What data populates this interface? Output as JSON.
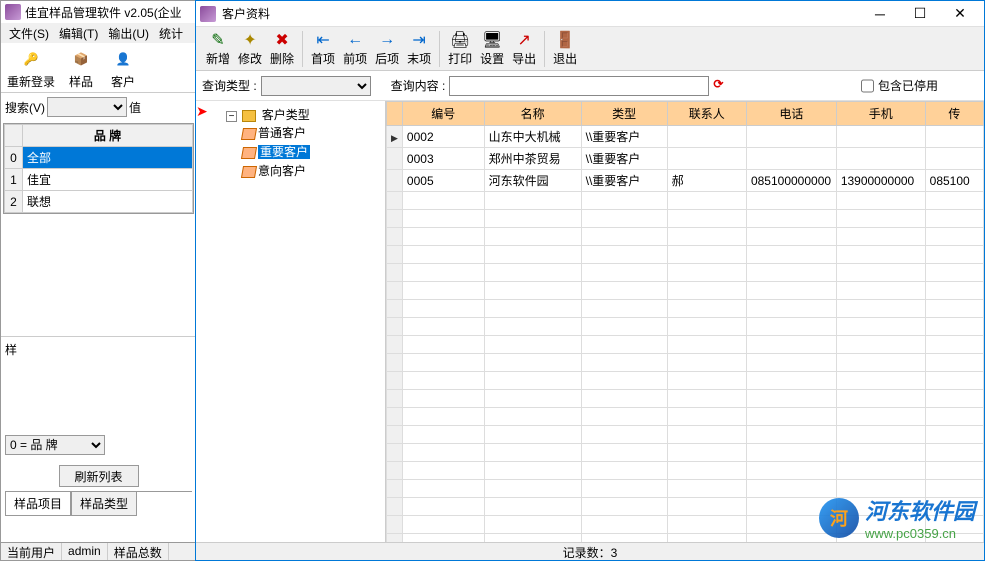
{
  "main_window": {
    "title": "佳宜样品管理软件 v2.05(企业",
    "menu": {
      "file": "文件(S)",
      "edit": "编辑(T)",
      "output": "输出(U)",
      "stat": "统计"
    },
    "toolbar": {
      "relogin": "重新登录",
      "sample": "样品",
      "customer": "客户"
    },
    "search": {
      "label": "搜索(V)",
      "val_label": "值"
    },
    "brand_grid": {
      "header": "品    牌",
      "rows": [
        {
          "idx": "0",
          "label": "全部",
          "selected": true
        },
        {
          "idx": "1",
          "label": "佳宜",
          "selected": false
        },
        {
          "idx": "2",
          "label": "联想",
          "selected": false
        }
      ]
    },
    "lower": {
      "select": "0 = 品    牌",
      "refresh": "刷新列表",
      "tab1": "样品项目",
      "tab2": "样品类型"
    },
    "status": {
      "user_label": "当前用户",
      "user": "admin",
      "total_label": "样品总数"
    }
  },
  "dialog": {
    "title": "客户资料",
    "toolbar": {
      "add": "新增",
      "edit": "修改",
      "delete": "删除",
      "first": "首项",
      "prev": "前项",
      "next": "后项",
      "last": "末项",
      "print": "打印",
      "settings": "设置",
      "export": "导出",
      "exit": "退出"
    },
    "search": {
      "type_label": "查询类型 :",
      "content_label": "查询内容 :",
      "include_stopped": "包含已停用"
    },
    "tree": {
      "root": "客户类型",
      "children": [
        {
          "label": "普通客户",
          "selected": false
        },
        {
          "label": "重要客户",
          "selected": true
        },
        {
          "label": "意向客户",
          "selected": false
        }
      ]
    },
    "grid": {
      "columns": [
        "编号",
        "名称",
        "类型",
        "联系人",
        "电话",
        "手机",
        "传"
      ],
      "rows": [
        {
          "id": "0002",
          "name": "山东中大机械",
          "type": "\\\\重要客户",
          "contact": "",
          "tel": "",
          "mobile": "",
          "fax": ""
        },
        {
          "id": "0003",
          "name": "郑州中茶贸易",
          "type": "\\\\重要客户",
          "contact": "",
          "tel": "",
          "mobile": "",
          "fax": ""
        },
        {
          "id": "0005",
          "name": "河东软件园",
          "type": "\\\\重要客户",
          "contact": "郝",
          "tel": "085100000000",
          "mobile": "13900000000",
          "fax": "085100"
        }
      ]
    },
    "status": {
      "record_count": "记录数：3"
    }
  },
  "watermark": {
    "cn": "河东软件园",
    "url": "www.pc0359.cn"
  }
}
